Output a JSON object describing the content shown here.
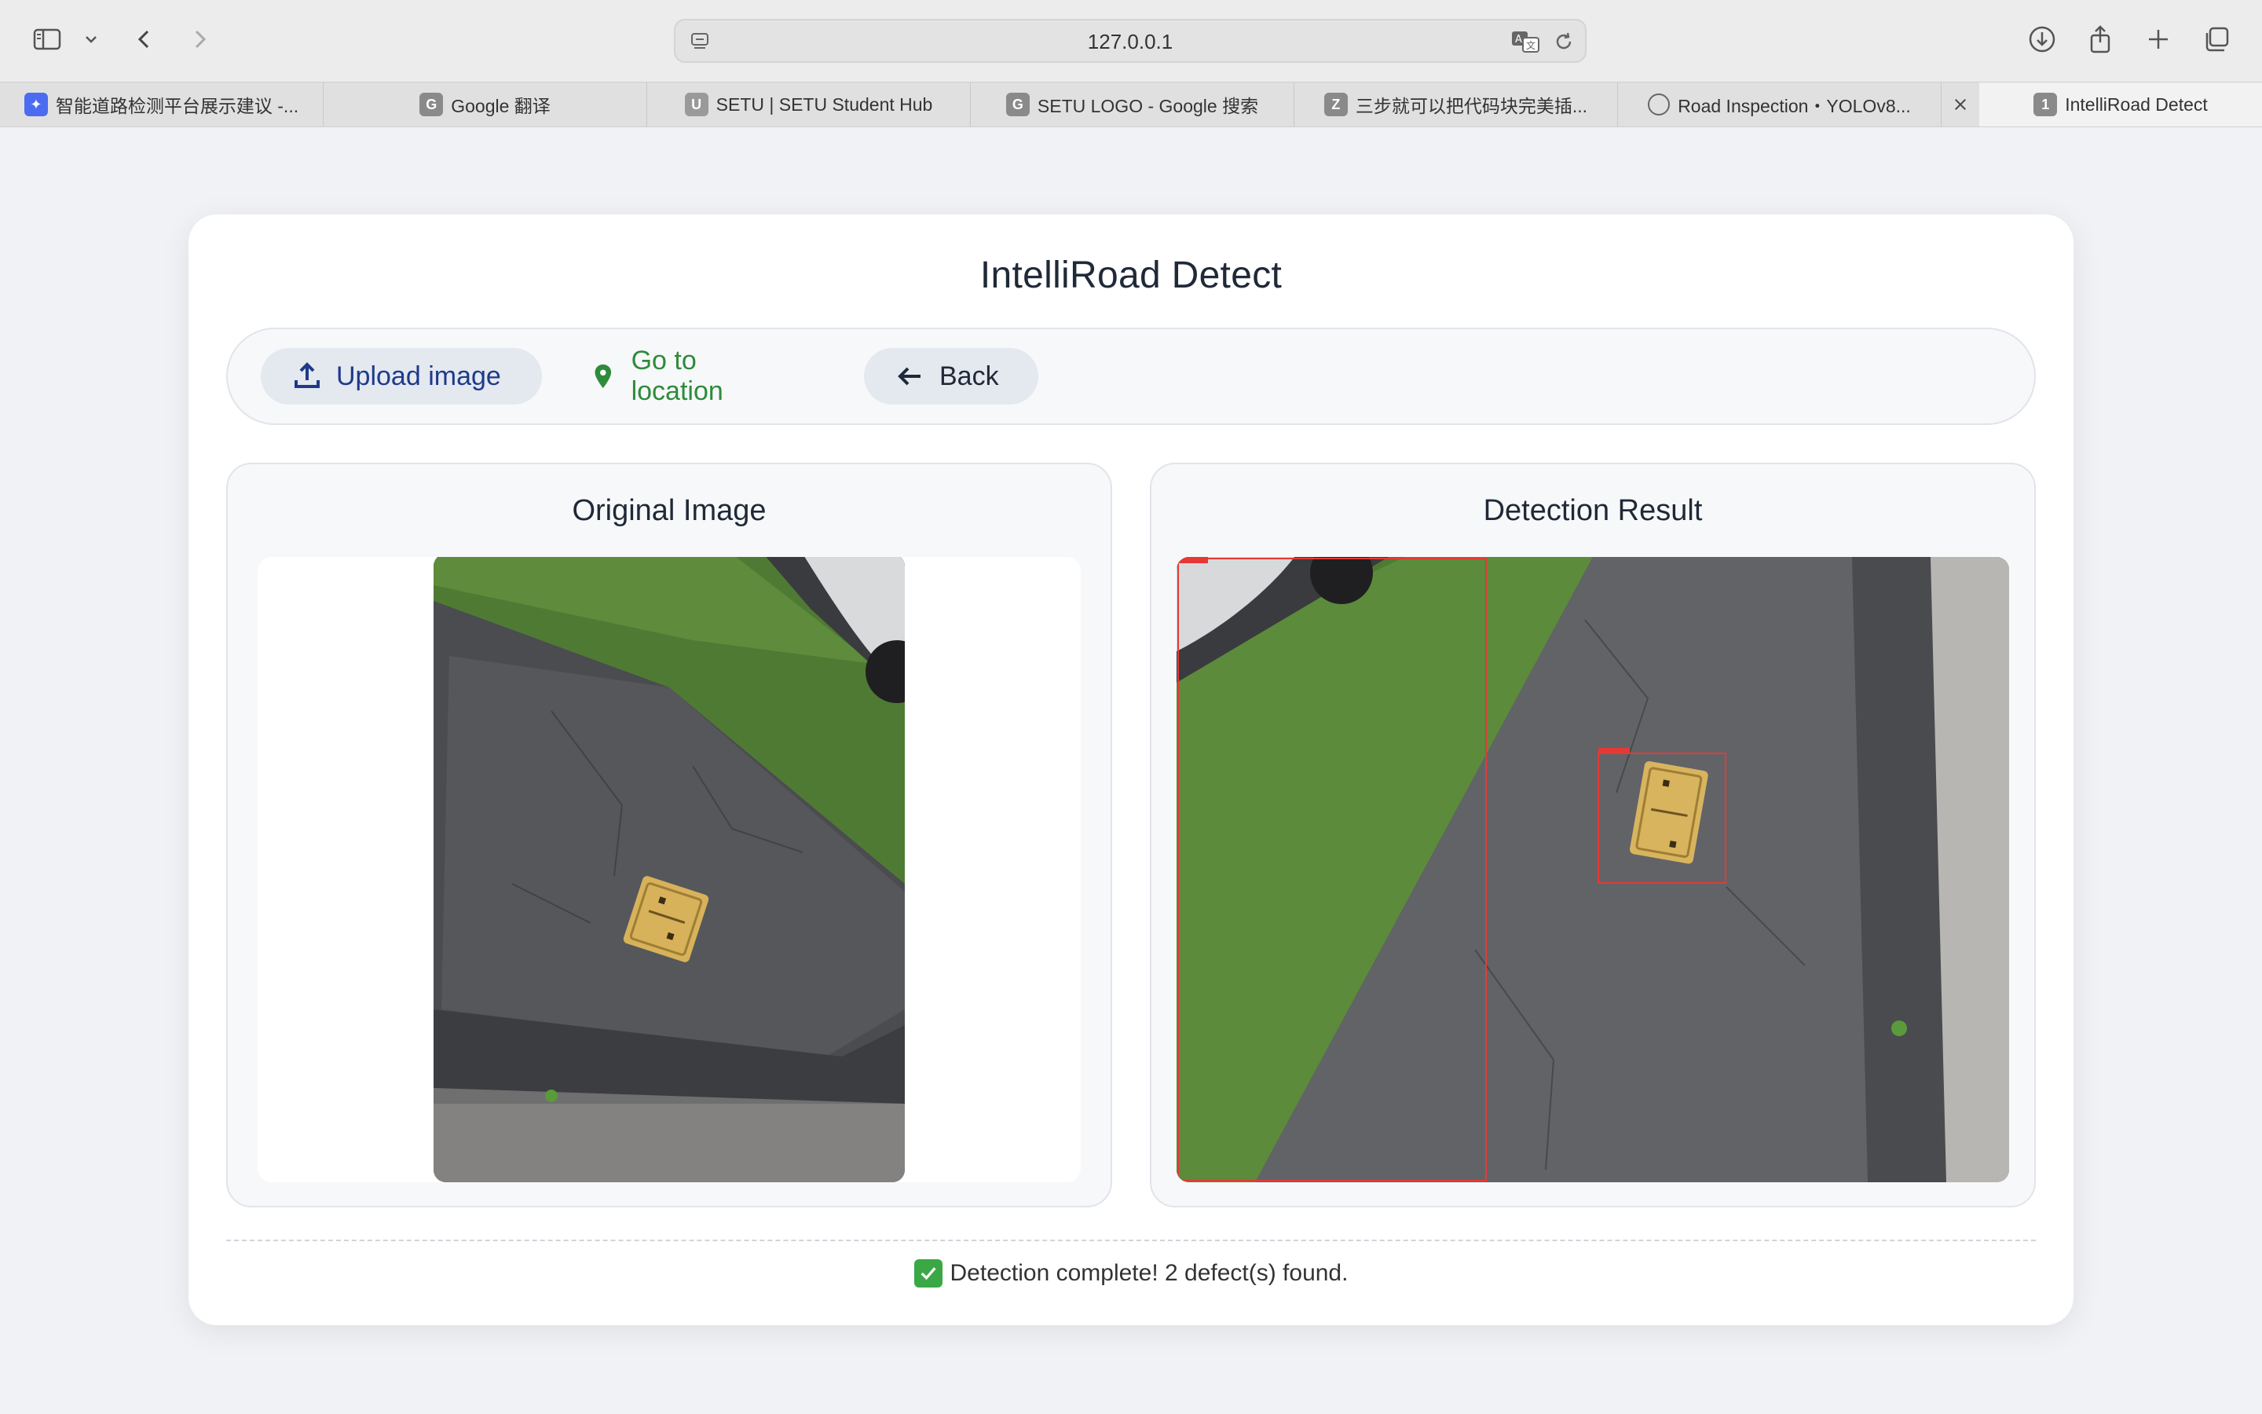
{
  "browser": {
    "address": "127.0.0.1",
    "tabs": [
      {
        "label": "智能道路检测平台展示建议 -...",
        "icon": "bird-icon"
      },
      {
        "label": "Google 翻译",
        "icon": "G"
      },
      {
        "label": "SETU | SETU Student Hub",
        "icon": "shield-icon"
      },
      {
        "label": "SETU LOGO - Google 搜索",
        "icon": "G"
      },
      {
        "label": "三步就可以把代码块完美插...",
        "icon": "Z"
      },
      {
        "label": "Road Inspection・YOLOv8...",
        "icon": "compass-icon"
      },
      {
        "label": "IntelliRoad Detect",
        "icon": "1"
      }
    ]
  },
  "page": {
    "title": "IntelliRoad Detect",
    "actions": {
      "upload": "Upload image",
      "location": "Go to location",
      "back": "Back"
    },
    "original_title": "Original Image",
    "result_title": "Detection Result",
    "status": "Detection complete! 2 defect(s) found."
  },
  "colors": {
    "accent_blue": "#1e3a8a",
    "accent_green": "#2e8b3a",
    "detection_box": "#e53935"
  }
}
